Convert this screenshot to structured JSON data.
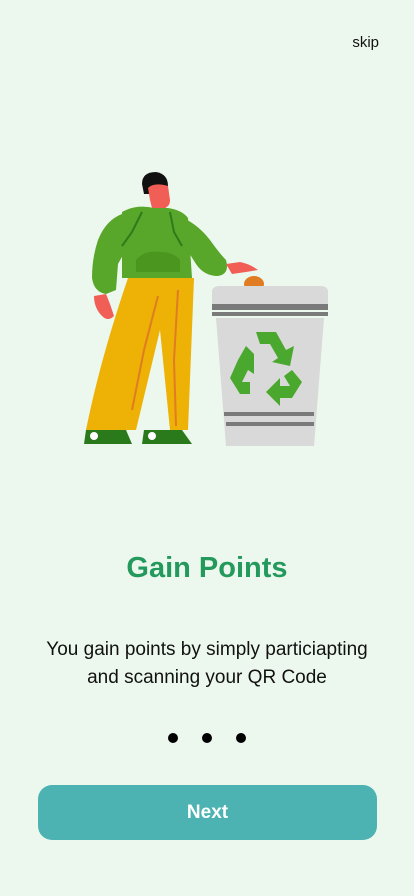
{
  "header": {
    "skip_label": "skip"
  },
  "illustration": {
    "icon": "recycle-person-icon"
  },
  "onboarding": {
    "title": "Gain Points",
    "description": "You gain points by simply particiapting and scanning your QR Code",
    "page_count": 3
  },
  "footer": {
    "next_label": "Next"
  },
  "colors": {
    "background": "#ecf8ee",
    "title": "#239a5c",
    "button": "#4cb3b2",
    "text": "#111111"
  }
}
